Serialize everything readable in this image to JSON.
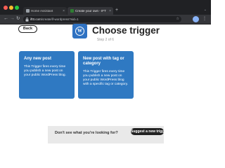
{
  "browser": {
    "tabs": [
      {
        "title": "Home Assistant",
        "active": false
      },
      {
        "title": "Create your own - IFTTT",
        "active": true
      }
    ],
    "new_tab": "+",
    "close_glyph": "×",
    "url_host": "ifttt.com",
    "url_path": "/create/if-wordpress?sid=1",
    "nav": {
      "back": "←",
      "forward": "→",
      "reload": "↻"
    },
    "star": "☆",
    "menu": "⋮",
    "tabs_menu": "⌄",
    "lock": "🔒"
  },
  "header": {
    "back_label": "Back",
    "logo_letter": "W",
    "title": "Choose trigger",
    "step": "Step 2 of 6"
  },
  "cards": [
    {
      "title": "Any new post",
      "description": "This Trigger fires every time you publish a new post on your public WordPress blog."
    },
    {
      "title": "New post with tag or category",
      "description": "This Trigger fires every time you publish a new post on your public WordPress blog with a specific tag or category."
    }
  ],
  "footer": {
    "text": "Don't see what you're looking for?",
    "button_label": "Suggest a new trigger"
  },
  "colors": {
    "card": "#2f79c2",
    "logo": "#2f72c2",
    "text": "#222222",
    "browser_chrome": "#202124"
  }
}
